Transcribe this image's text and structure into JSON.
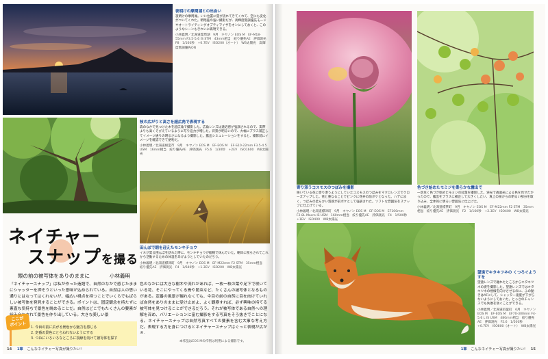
{
  "left_page": {
    "photo1_caption": {
      "title": "夜明けの摩周湖との出会い",
      "desc": "夜明けの摩周湖。いい位置に雲が流れてきてくれて、空にも変化がついてくれた。明暗差の強い撮影だが、高輝度階調優先モードやオートライティングオプティマイザをオンにしておくと、このようなシーンもきれいに再現できる。",
      "exif": "小林義明／北海道摩周湖　9月　キヤノン EOS M　EF-M18-55mm F3.5-5.6 IS STM　43mm相当　絞り優先AE　評価測光　F8　1/160秒　+0.7EV　ISO200（オート）　WB太陽光　高輝度階調優先ON"
    },
    "photo2_caption": {
      "title": "枝の広がりと高さを超広角で表現する",
      "desc": "森のなかで見つけた木を超広角で撮影した。広角レンズは遠近感が強調されるので、実際よりも高くそびえているように写り迫力が増した。背景が明るいので、大幅にプラス補正してイメージ通りの明るさになるよう撮影した。露出シミュレーションをすると、撮影前にイメージを確認できて便利だ。",
      "exif": "小林義明／北海道根室市　9月　キヤノン EOS M　EF-EOS M　EF-S10-22mm F3.5-4.5 USM　16mm相当　絞り優先AE　評価測光　F5.6　1/30秒　+2EV　ISO1600　WB太陽光"
    },
    "photo3_caption": {
      "title": "田んぼで朝を迎えたモンキチョウ",
      "desc": "イネが実る田んぼを訪れた時に、モンキチョウが稲穂で休んでいた。朝日に照らされてこれから活動するための体温をあげようとしていたのだろう。",
      "exif": "小林義明／北海道標津町　9月　キヤノン EOS M　EF-M22mm F2 STM　35mm相当　絞り優先AE　評価測光　F4　1/640秒　+1.3EV　ISO200　WB太陽光"
    },
    "title_line1": "ネイチャー",
    "title_line2": "スナップ",
    "title_suffix": "を撮る",
    "subtitle": "眼の前の被写体をありのままに",
    "author": "小林義明",
    "body_col1": "「ネイチャースナップ」は私が作った造語で、自然のなかで感じたままにシャッターを押そうといった意味が込められている。自然は人の思い通りにはなってはくれないが、幅広い視点を持つことでいくらでもぱらしい被写体を発見することができる。ポイントは、固定観念を持たずに素直な気持ちで景色を眺めることだ。自然はどこでもたくさんの要素が組み合わされて景色を作り出している。大きな美しい景",
    "body_col2": "色のなかには大きな樹木や流れがあれば、一枚一枚の葉や足下で咲いている花、そこにやってくる鳥や昆虫など、たくさんの被写体となるものがある。定番の風景が撮れなくても、今目の前の自然に目を向けていれば自然をありのままに受け止めよ、よく観察すれば、必ず興味の持てる被写体を見つけることができるだろう。それが被写体である自然への理解を深め、バリエーションに富む撮影をする写真をそろ抜きでことになる。ネイチャースナップは自然写真すべての要素を含む大事な考え方だ。表現する力を身につけるとネイチャースナップはぐっと表現が広がる。",
    "point_badge": "ここが\nポイント",
    "points": [
      "1. 今目の前に広がる景色から魅力を感じる",
      "2. 定番の景色にとらわれないようにする",
      "3. つねにいろいろなところに視線を向けて被写体を探す"
    ],
    "note": "本作品はEOS Mの作例は利用による撮影です。",
    "footer_num": "14",
    "footer_chapter": "1章",
    "footer_text": "こんなネイチャー写真が撮りたい!"
  },
  "right_page": {
    "photo4_caption": {
      "title": "寄り添うコスモスのつぼみを撮影",
      "desc": "咲いている花に寄り添うようにしていたコスモスのつぼみをマクロレンズでクローズアップした。花と重なることでピンクに花弁の前ボケとなった。ハデに淡く、つぼみの柔らかい質感が前ボケとして強調された。ソフトな雰囲気をスナップに仕上げている。",
      "exif": "小林義明／北海道標津町　9月　キヤノン EOS M　EF-EOS M　EF100mm F2.8L Macro IS USM　160mm相当　絞り優先AE　評価測光　F4　1/500秒　+1EV　ISO400　WB太陽光"
    },
    "photo5_caption": {
      "title": "色づき始めたモミジを柔らかな露出で",
      "desc": "一足早く色づき始めたモミジの紅葉を撮影した。逆光で透過光による色を見せたかったので、露出をプラスに補正して大きくしたい、真上の枝からの明るい部分を取り込み、全体的に明るい雰囲気に仕上げた。",
      "exif": "小林義明／北海道標茶町　9月　キヤノン EOS M　EF-M22mm F2 STM　35mm相当　絞り優先AE　評価測光　F2　1/160秒　+2.3EV　ISO400　WB太陽光"
    },
    "photo6_caption": {
      "title": "望遠でキタキツネの くつろぐようすを",
      "desc": "望遠レンズで離れたところからキタキツネの姿を撮影した。望遠レンズではキタキツネの視線を向けさせるのに、ふの動きはAFにして、シャッター速度が下がらないようにしておいた。とっさのチャンスでも失敗を防ぐことができる。",
      "exif": "小林義明／北海道斜里町　6月　キヤノン EOS M　EF-EOS M　EF70-300mm F4-5.6 L IS USM　480mm相当　絞り優先AE　評価測光　F5.6　1/500秒　+0.7EV　ISO800（オート）　WB太陽光"
    },
    "footer_num": "15",
    "footer_chapter": "1章",
    "footer_text": "こんなネイチャー写真が撮りたい!"
  }
}
